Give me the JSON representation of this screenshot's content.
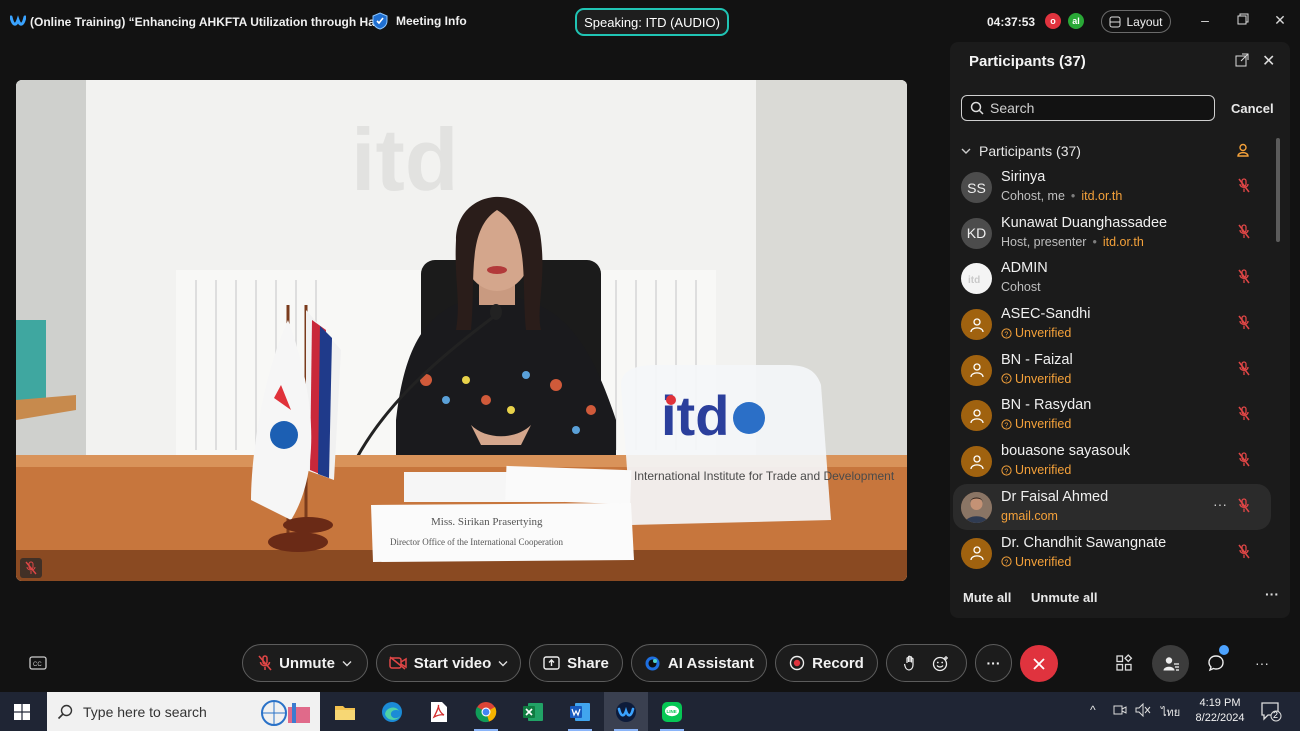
{
  "window": {
    "title": "(Online Training) “Enhancing AHKFTA Utilization through Ha...",
    "meeting_info": "Meeting Info",
    "speaking": "Speaking: ITD (AUDIO)",
    "elapsed": "04:37:53",
    "indicators": [
      {
        "letter": "o",
        "color": "#e0333e"
      },
      {
        "letter": "al",
        "color": "#29a836"
      }
    ],
    "layout_label": "Layout"
  },
  "video": {
    "backdrop_logo": "itd",
    "desk_logo": "itd",
    "desk_sign": "International Institute for Trade and Development",
    "name_plate_name": "Miss. Sirikan Prasertying",
    "name_plate_title": "Director Office of the International Cooperation"
  },
  "participants_panel": {
    "title": "Participants (37)",
    "search_placeholder": "Search",
    "cancel": "Cancel",
    "section_label": "Participants (37)",
    "items": [
      {
        "initials": "SS",
        "avatar": "initials",
        "name": "Sirinya",
        "role": "Cohost, me",
        "org": "itd.or.th"
      },
      {
        "initials": "KD",
        "avatar": "initials",
        "name": "Kunawat Duanghassadee",
        "role": "Host, presenter",
        "org": "itd.or.th"
      },
      {
        "initials": "",
        "avatar": "admin",
        "name": "ADMIN",
        "role": "Cohost",
        "org": ""
      },
      {
        "initials": "",
        "avatar": "guest",
        "name": "ASEC-Sandhi",
        "role": "",
        "org": "",
        "unverified": "Unverified"
      },
      {
        "initials": "",
        "avatar": "guest",
        "name": "BN - Faizal",
        "role": "",
        "org": "",
        "unverified": "Unverified"
      },
      {
        "initials": "",
        "avatar": "guest",
        "name": "BN - Rasydan",
        "role": "",
        "org": "",
        "unverified": "Unverified"
      },
      {
        "initials": "",
        "avatar": "guest",
        "name": "bouasone sayasouk",
        "role": "",
        "org": "",
        "unverified": "Unverified"
      },
      {
        "initials": "",
        "avatar": "photo",
        "name": "Dr Faisal Ahmed",
        "role": "",
        "org": "gmail.com",
        "hover": true
      },
      {
        "initials": "",
        "avatar": "guest",
        "name": "Dr. Chandhit Sawangnate",
        "role": "",
        "org": "",
        "unverified": "Unverified"
      }
    ],
    "mute_all": "Mute all",
    "unmute_all": "Unmute all"
  },
  "controls": {
    "unmute": "Unmute",
    "start_video": "Start video",
    "share": "Share",
    "ai_assistant": "AI Assistant",
    "record": "Record",
    "chat_badge_color": "#4da3ff",
    "end_color": "#e0333e"
  },
  "taskbar": {
    "search_placeholder": "Type here to search",
    "time": "4:19 PM",
    "date": "8/22/2024",
    "lang": "ไทย",
    "notifications": "2",
    "apps": [
      "file-explorer",
      "edge",
      "acrobat",
      "chrome",
      "excel",
      "word",
      "webex",
      "line"
    ]
  }
}
